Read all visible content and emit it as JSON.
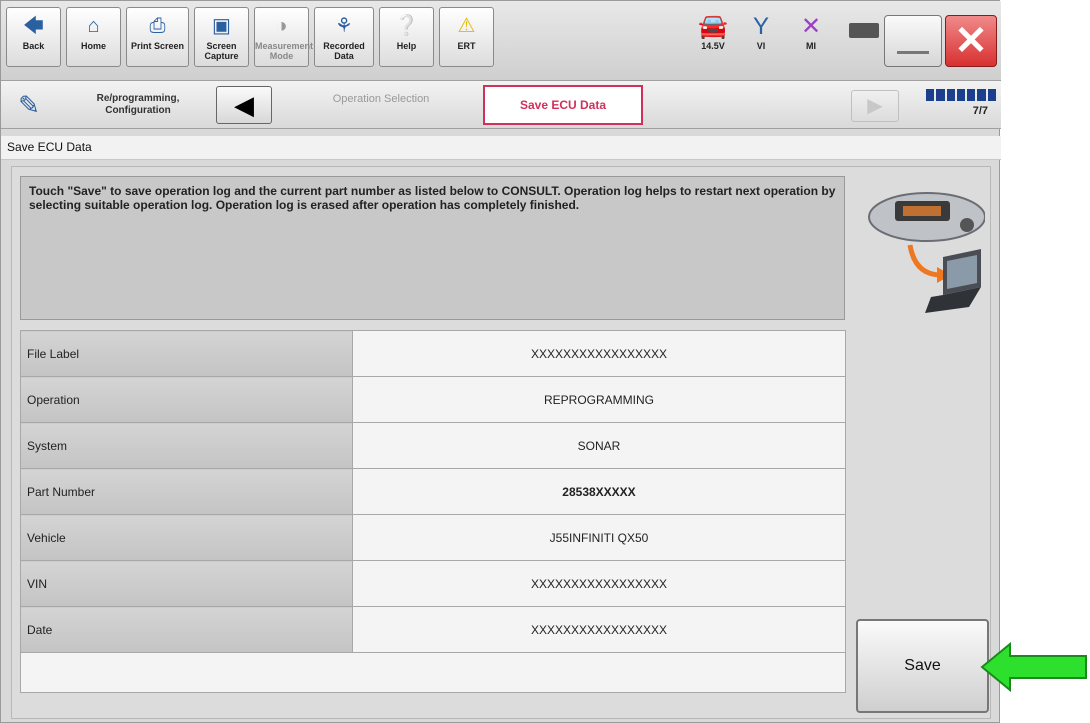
{
  "toolbar": {
    "buttons": [
      {
        "label": "Back",
        "icon": "back-arrow-icon"
      },
      {
        "label": "Home",
        "icon": "home-icon"
      },
      {
        "label": "Print Screen",
        "icon": "printer-icon"
      },
      {
        "label": "Screen Capture",
        "icon": "camera-icon"
      },
      {
        "label": "Measurement Mode",
        "icon": "gauge-icon"
      },
      {
        "label": "Recorded Data",
        "icon": "recorded-data-icon"
      },
      {
        "label": "Help",
        "icon": "help-icon"
      },
      {
        "label": "ERT",
        "icon": "warning-icon"
      }
    ],
    "status": {
      "voltage": "14.5V",
      "vi": "VI",
      "mi": "MI"
    }
  },
  "breadcrumb": {
    "mode_label": "Re/programming, Configuration",
    "step_prev": "Operation Selection",
    "step_current": "Save ECU Data",
    "step_count": "7/7"
  },
  "section_title": "Save ECU Data",
  "message": "Touch \"Save\" to save operation log and the current part number as listed below to CONSULT. Operation log helps to restart next operation by selecting suitable operation log. Operation log is erased after operation has completely finished.",
  "rows": [
    {
      "label": "File Label",
      "value": "XXXXXXXXXXXXXXXXX"
    },
    {
      "label": "Operation",
      "value": "REPROGRAMMING"
    },
    {
      "label": "System",
      "value": "SONAR"
    },
    {
      "label": "Part Number",
      "value": "28538XXXXX"
    },
    {
      "label": "Vehicle",
      "value": "J55INFINITI QX50"
    },
    {
      "label": "VIN",
      "value": "XXXXXXXXXXXXXXXXX"
    },
    {
      "label": "Date",
      "value": "XXXXXXXXXXXXXXXXX"
    }
  ],
  "save_button": "Save",
  "colors": {
    "accent": "#d0305a",
    "arrow": "#22cc22",
    "progress": "#1b3f8c"
  }
}
